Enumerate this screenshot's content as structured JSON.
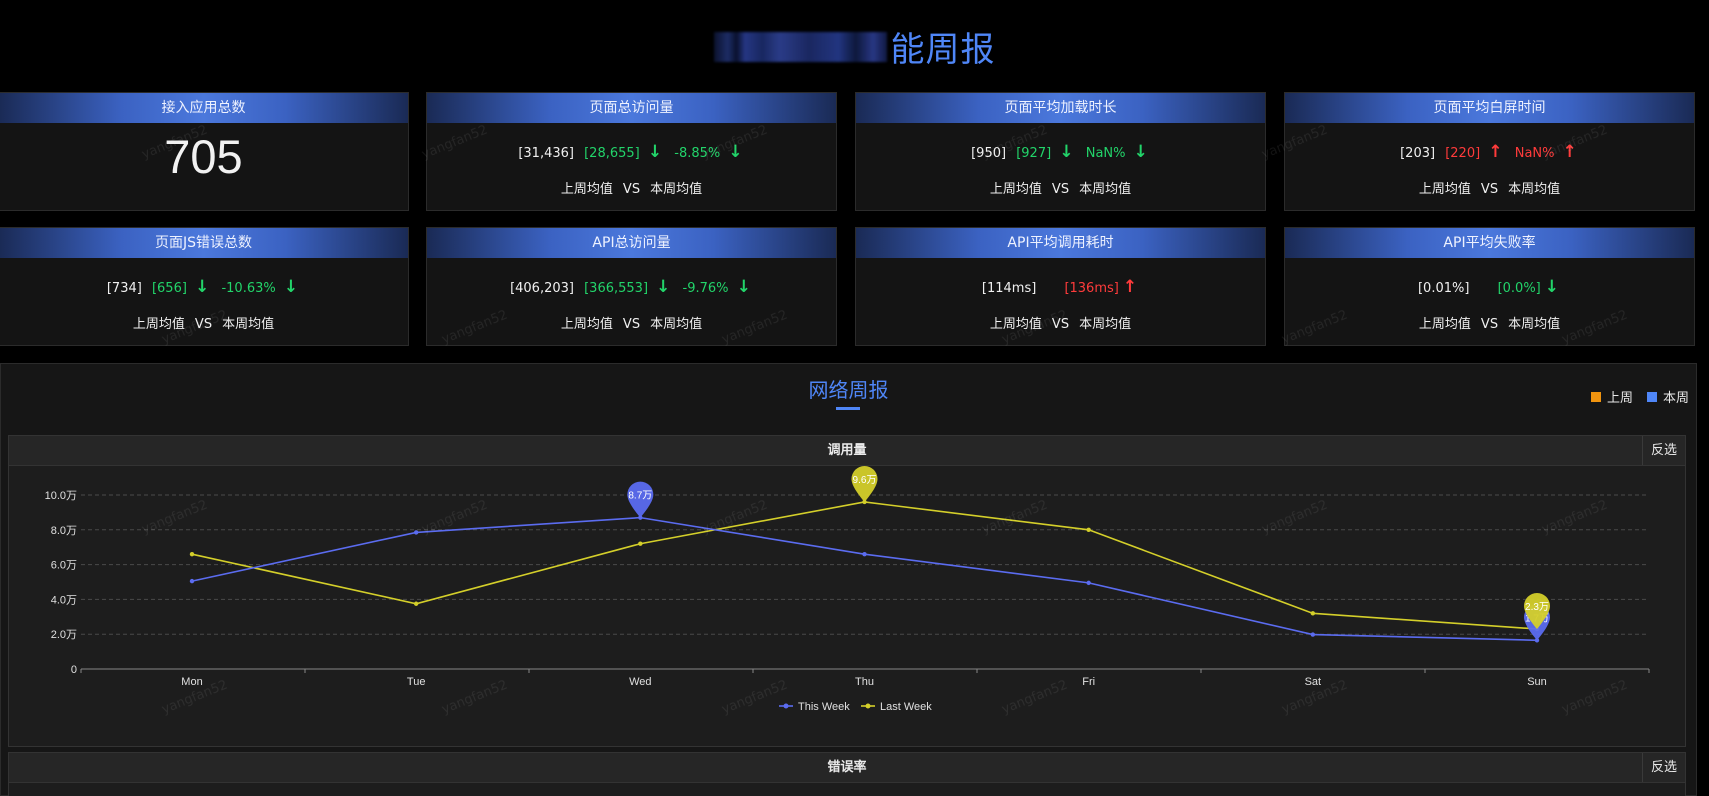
{
  "header": {
    "title": "能周报"
  },
  "cards": [
    {
      "title": "接入应用总数",
      "big": "705"
    },
    {
      "title": "页面总访问量",
      "v1": "[31,436]",
      "v2": "[28,655]",
      "a2": "↓",
      "v3": "-8.85%",
      "a3": "↓",
      "c2": "green",
      "c3": "green",
      "compare": [
        "上周均值",
        "VS",
        "本周均值"
      ]
    },
    {
      "title": "页面平均加载时长",
      "v1": "[950]",
      "v2": "[927]",
      "a2": "↓",
      "v3": "NaN%",
      "a3": "↓",
      "c2": "green",
      "c3": "green",
      "compare": [
        "上周均值",
        "VS",
        "本周均值"
      ]
    },
    {
      "title": "页面平均白屏时间",
      "v1": "[203]",
      "v2": "[220]",
      "a2": "↑",
      "v3": "NaN%",
      "a3": "↑",
      "c2": "red",
      "c3": "red",
      "compare": [
        "上周均值",
        "VS",
        "本周均值"
      ]
    },
    {
      "title": "页面JS错误总数",
      "v1": "[734]",
      "v2": "[656]",
      "a2": "↓",
      "v3": "-10.63%",
      "a3": "↓",
      "c2": "green",
      "c3": "green",
      "compare": [
        "上周均值",
        "VS",
        "本周均值"
      ]
    },
    {
      "title": "API总访问量",
      "v1": "[406,203]",
      "v2": "[366,553]",
      "a2": "↓",
      "v3": "-9.76%",
      "a3": "↓",
      "c2": "green",
      "c3": "green",
      "compare": [
        "上周均值",
        "VS",
        "本周均值"
      ]
    },
    {
      "title": "API平均调用耗时",
      "v1": "[114ms]",
      "v2": "[136ms]",
      "a2": "↑",
      "v3": "",
      "a3": "",
      "c2": "red",
      "c3": "red",
      "compare": [
        "上周均值",
        "VS",
        "本周均值"
      ]
    },
    {
      "title": "API平均失败率",
      "v1": "[0.01%]",
      "v2": "[0.0%]",
      "a2": "↓",
      "v3": "",
      "a3": "",
      "c2": "green",
      "c3": "green",
      "compare": [
        "上周均值",
        "VS",
        "本周均值"
      ]
    }
  ],
  "network": {
    "title": "网络周报",
    "legend": [
      {
        "label": "上周",
        "color": "#f0940f"
      },
      {
        "label": "本周",
        "color": "#4f86f7"
      }
    ],
    "panels": [
      {
        "title": "调用量",
        "invert_label": "反选"
      },
      {
        "title": "错误率",
        "invert_label": "反选"
      }
    ]
  },
  "watermark_text": "yangfan52",
  "chart_data": {
    "type": "line",
    "x": [
      "Mon",
      "Tue",
      "Wed",
      "Thu",
      "Fri",
      "Sat",
      "Sun"
    ],
    "ylim": [
      0,
      100000
    ],
    "yticks": [
      0,
      20000,
      40000,
      60000,
      80000,
      100000
    ],
    "ytick_labels": [
      "0",
      "2.0万",
      "4.0万",
      "6.0万",
      "8.0万",
      "10.0万"
    ],
    "series": [
      {
        "name": "This Week",
        "color": "#5b6cf0",
        "values": [
          50500,
          78500,
          87000,
          66000,
          49500,
          19800,
          16500
        ],
        "markers": [
          {
            "index": 2,
            "label": "8.7万"
          },
          {
            "index": 6,
            "label": "1.7万"
          }
        ]
      },
      {
        "name": "Last Week",
        "color": "#d4cf2a",
        "values": [
          66000,
          37500,
          72000,
          96000,
          80000,
          32000,
          23000
        ],
        "markers": [
          {
            "index": 3,
            "label": "9.6万"
          },
          {
            "index": 6,
            "label": "2.3万"
          }
        ]
      }
    ],
    "grid": true,
    "legend_position": "bottom-center"
  }
}
